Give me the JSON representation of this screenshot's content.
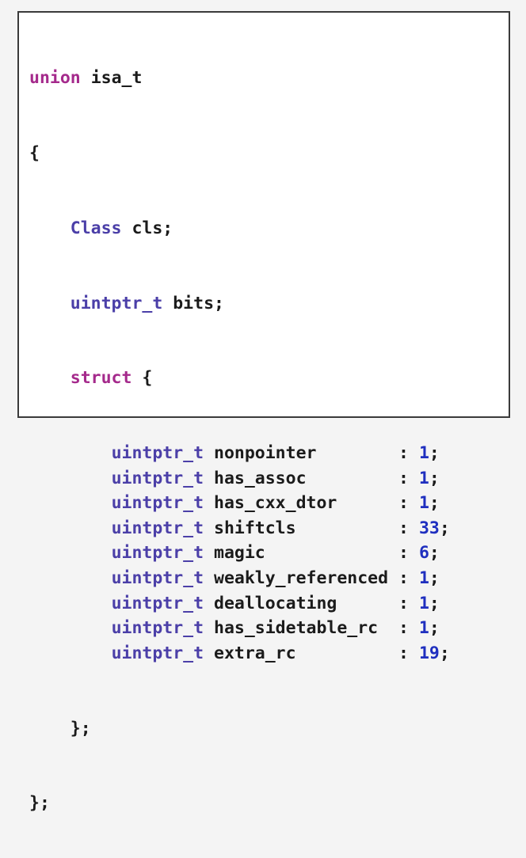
{
  "code": {
    "union_keyword": "union",
    "union_name": "isa_t",
    "open_brace": "{",
    "members": [
      {
        "type": "Class",
        "name": "cls;"
      },
      {
        "type": "uintptr_t",
        "name": "bits;"
      }
    ],
    "struct_keyword": "struct",
    "struct_open": "{",
    "bitfields": [
      {
        "type": "uintptr_t",
        "name": "nonpointer",
        "colon": ":",
        "bits": "1",
        "semi": ";"
      },
      {
        "type": "uintptr_t",
        "name": "has_assoc",
        "colon": ":",
        "bits": "1",
        "semi": ";"
      },
      {
        "type": "uintptr_t",
        "name": "has_cxx_dtor",
        "colon": ":",
        "bits": "1",
        "semi": ";"
      },
      {
        "type": "uintptr_t",
        "name": "shiftcls",
        "colon": ":",
        "bits": "33",
        "semi": ";"
      },
      {
        "type": "uintptr_t",
        "name": "magic",
        "colon": ":",
        "bits": "6",
        "semi": ";"
      },
      {
        "type": "uintptr_t",
        "name": "weakly_referenced",
        "colon": ":",
        "bits": "1",
        "semi": ";"
      },
      {
        "type": "uintptr_t",
        "name": "deallocating",
        "colon": ":",
        "bits": "1",
        "semi": ";"
      },
      {
        "type": "uintptr_t",
        "name": "has_sidetable_rc",
        "colon": ":",
        "bits": "1",
        "semi": ";"
      },
      {
        "type": "uintptr_t",
        "name": "extra_rc",
        "colon": ":",
        "bits": "19",
        "semi": ";"
      }
    ],
    "struct_close": "};",
    "union_close": "};"
  },
  "colors": {
    "keyword": "#a52a8c",
    "type": "#4b3fa8",
    "number": "#1f2fbf",
    "text": "#1b1b1b"
  }
}
